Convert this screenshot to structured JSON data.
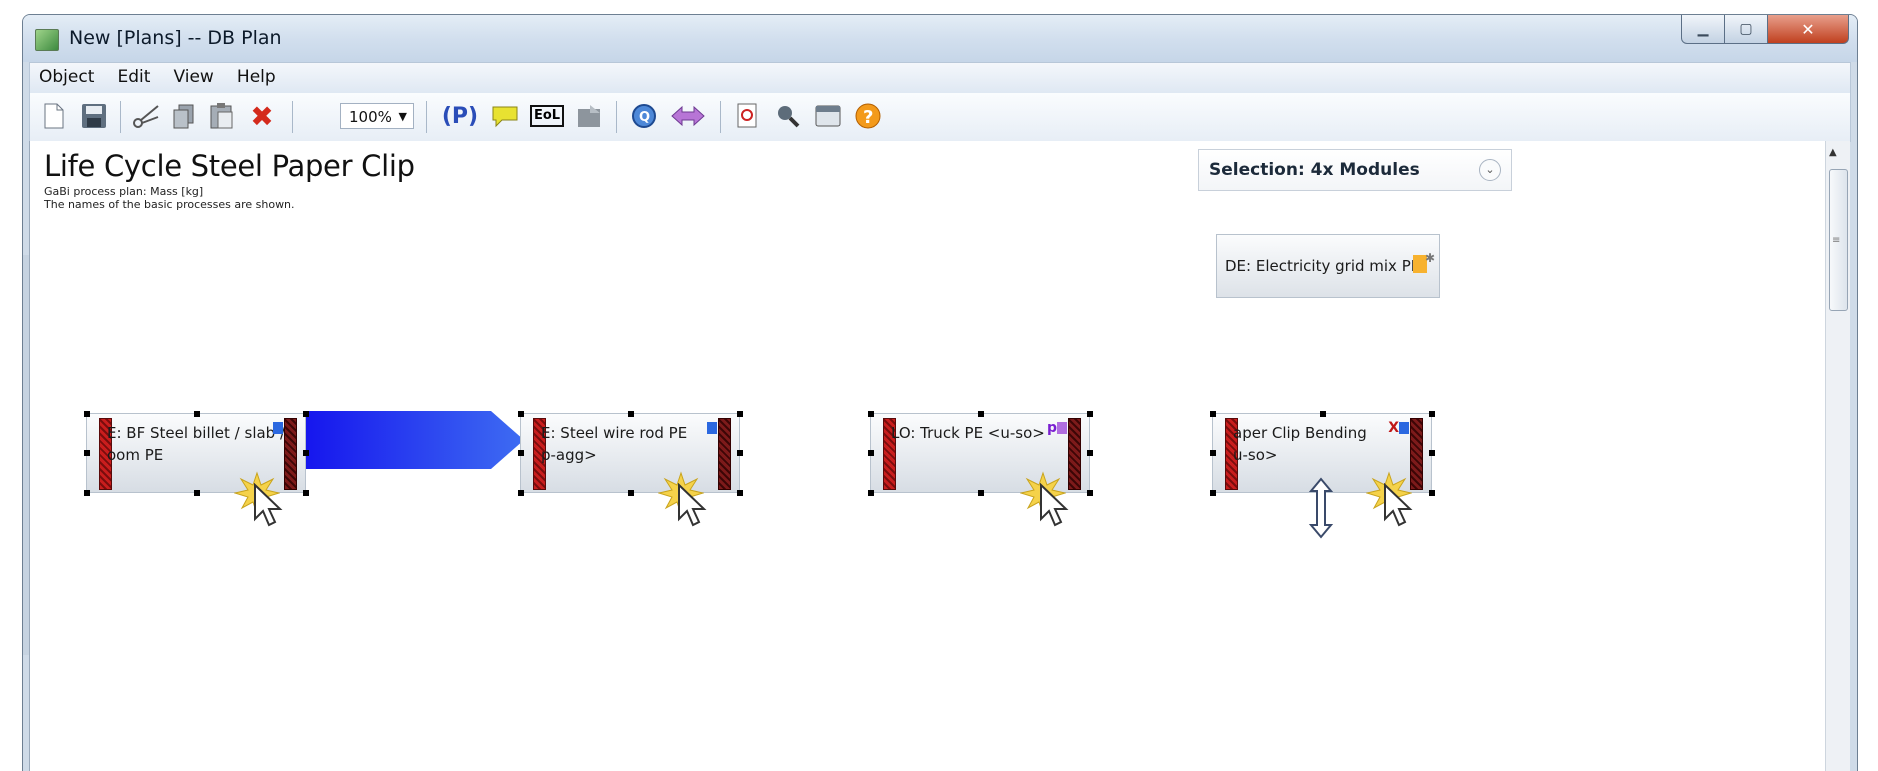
{
  "window": {
    "title": "New [Plans] -- DB Plan",
    "buttons": [
      "minimize",
      "maximize",
      "close"
    ]
  },
  "menu": [
    "Object",
    "Edit",
    "View",
    "Help"
  ],
  "toolbar": {
    "zoom": "100%",
    "eol_label": "EoL",
    "p_label": "(P)",
    "icons": [
      "new-file-icon",
      "save-icon",
      "cut-icon",
      "copy-icon",
      "paste-icon",
      "delete-icon",
      "plan-icon",
      "comment-icon",
      "eol-icon",
      "export-icon",
      "quantities-icon",
      "flow-arrows-icon",
      "zoom-page-icon",
      "search-icon",
      "window-icon",
      "help-icon"
    ]
  },
  "plan": {
    "title": "Life Cycle Steel Paper Clip",
    "subtitle1": "GaBi process plan: Mass [kg]",
    "subtitle2": "The names of the basic processes are shown."
  },
  "selection": {
    "label": "Selection: 4x Modules"
  },
  "electricity": {
    "label": "DE: Electricity grid mix PE"
  },
  "processes": [
    {
      "line1": "E: BF Steel billet / slab /",
      "line2": "oom PE",
      "flag": ""
    },
    {
      "line1": "E: Steel wire rod PE",
      "line2": "p-agg>",
      "flag": ""
    },
    {
      "line1": "LO: Truck PE <u-so>",
      "line2": "",
      "flag": "p"
    },
    {
      "line1": "aper Clip Bending",
      "line2": "u-so>",
      "flag": "X"
    }
  ],
  "colors": {
    "flow": "#1a1ef0",
    "flow_end": "#3c6cf2",
    "window_frame": "#cfdbe8",
    "close_button": "#c0401f"
  }
}
